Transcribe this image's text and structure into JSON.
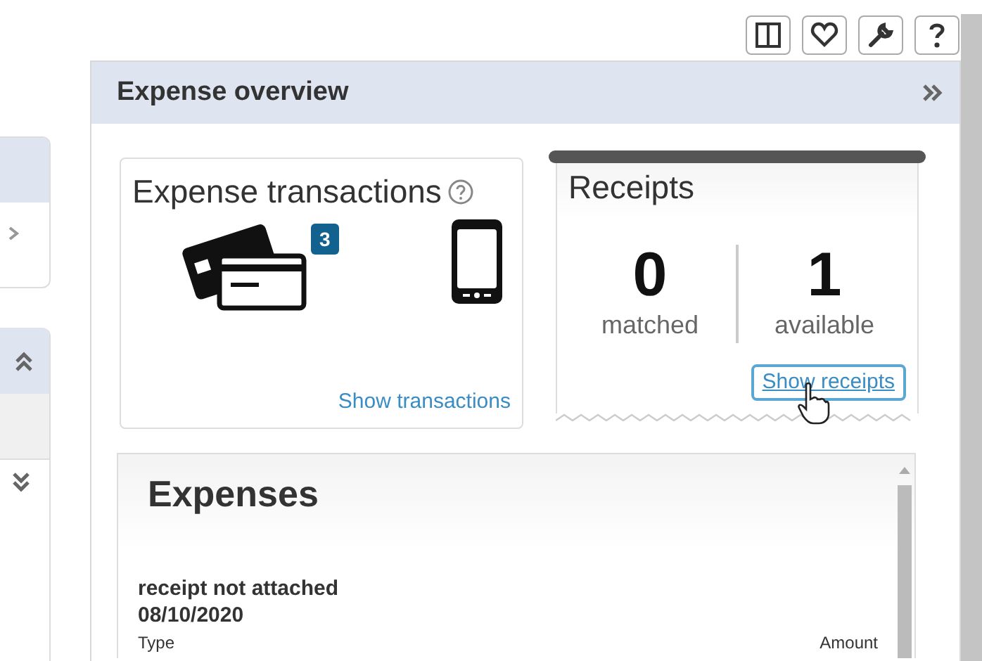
{
  "toolbar": [
    {
      "kind": "columns"
    },
    {
      "kind": "favorite"
    },
    {
      "kind": "settings"
    },
    {
      "kind": "help"
    }
  ],
  "panel": {
    "title": "Expense overview"
  },
  "transactions": {
    "title": "Expense transactions",
    "card_count": "3",
    "link": "Show transactions"
  },
  "receipts": {
    "title": "Receipts",
    "stats": [
      {
        "value": "0",
        "label": "matched"
      },
      {
        "value": "1",
        "label": "available"
      }
    ],
    "link": "Show receipts"
  },
  "expenses": {
    "title": "Expenses",
    "items": [
      {
        "status": "receipt not attached",
        "date": "08/10/2020"
      }
    ],
    "columns": [
      "Type",
      "Amount"
    ]
  }
}
